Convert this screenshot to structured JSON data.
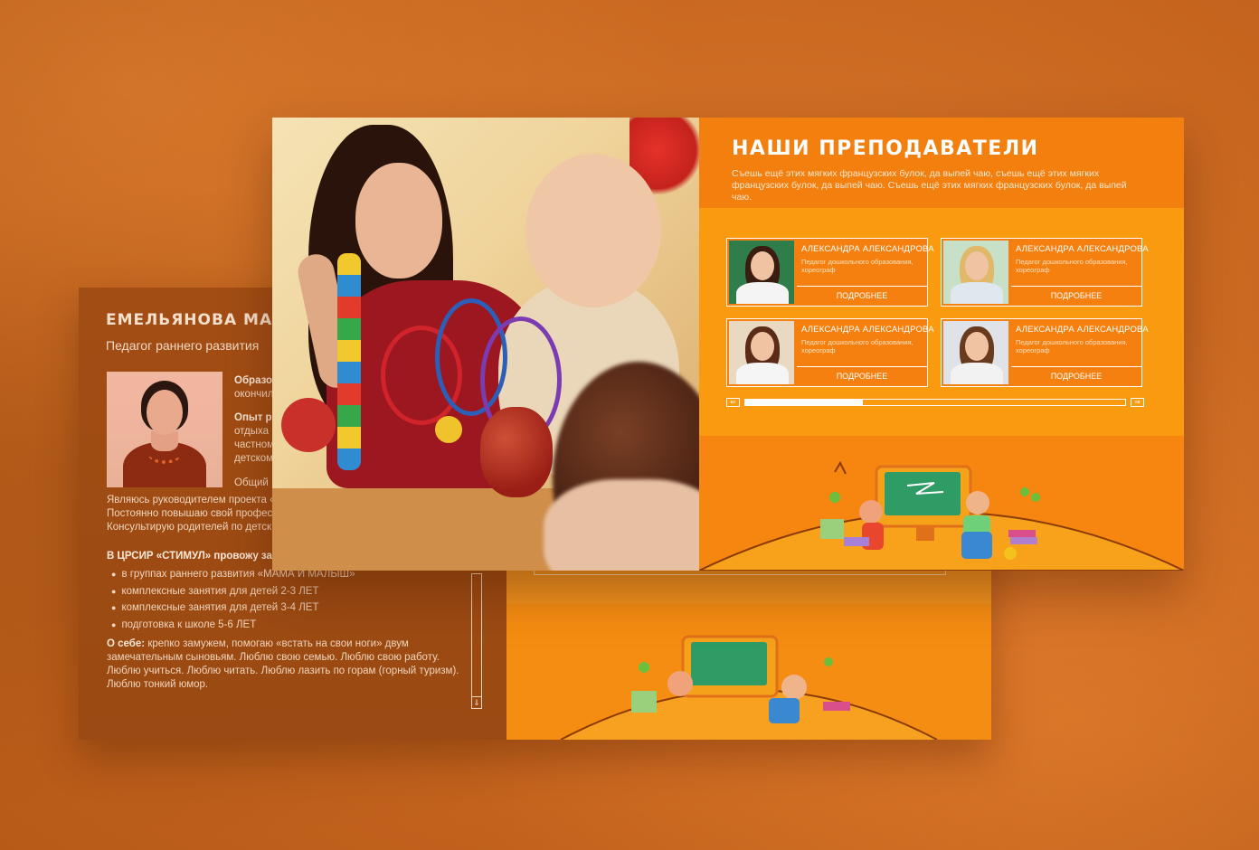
{
  "profile": {
    "name": "ЕМЕЛЬЯНОВА МАРИ",
    "role": "Педагог раннего развития",
    "education_label": "Образов",
    "education_text": "окончил",
    "experience_label": "Опыт ра",
    "experience_lines": [
      "отдыха",
      "частном",
      "детском"
    ],
    "general": "Общий",
    "lines": [
      "Являюсь руководителем проекта «",
      "Постоянно повышаю свой профес",
      "Консультирую родителей по детск"
    ],
    "center_heading": "В ЦРСИР «СТИМУЛ» провожу зан",
    "activities": [
      "в группах раннего развития «МАМА И МАЛЫШ»",
      "комплексные занятия для детей  2-3 ЛЕТ",
      "комплексные занятия для детей  3-4 ЛЕТ",
      "подготовка к школе  5-6 ЛЕТ"
    ],
    "about_label": "О себе:",
    "about_text": "крепко замужем, помогаю «встать на свои ноги» двум замечательным сыновьям. Люблю свою семью. Люблю свою работу. Люблю учиться. Люблю читать. Люблю лазить по горам (горный туризм). Люблю тонкий юмор."
  },
  "teachers_section": {
    "title": "НАШИ ПРЕПОДАВАТЕЛИ",
    "description": "Съешь ещё этих мягких французских булок, да выпей чаю, съешь ещё этих мягких французских булок, да выпей чаю. Съешь ещё этих мягких французских булок, да выпей чаю.",
    "teachers": [
      {
        "name": "АЛЕКСАНДРА АЛЕКСАНДРОВА",
        "role": "Педагог дошкольного образования, хореограф",
        "more": "ПОДРОБНЕЕ",
        "bg": "#2f7d4a",
        "hair": "#3a1d10",
        "shirt": "#f4f4f4"
      },
      {
        "name": "АЛЕКСАНДРА АЛЕКСАНДРОВА",
        "role": "Педагог дошкольного образования, хореограф",
        "more": "ПОДРОБНЕЕ",
        "bg": "#c8e0c8",
        "hair": "#e0b867",
        "shirt": "#dfe8ef"
      },
      {
        "name": "АЛЕКСАНДРА АЛЕКСАНДРОВА",
        "role": "Педагог дошкольного образования, хореограф",
        "more": "ПОДРОБНЕЕ",
        "bg": "#e9d9c2",
        "hair": "#5a2c18",
        "shirt": "#f5f5f5"
      },
      {
        "name": "АЛЕКСАНДРА АЛЕКСАНДРОВА",
        "role": "Педагог дошкольного образования, хореограф",
        "more": "ПОДРОБНЕЕ",
        "bg": "#dfe3e7",
        "hair": "#6a3a1e",
        "shirt": "#f2f2f2"
      }
    ],
    "slider_progress": 0.31,
    "prev_arrow": "⇐",
    "next_arrow": "⇒"
  },
  "colors": {
    "accent": "#f8910f",
    "profile_bg": "#a24d14"
  }
}
